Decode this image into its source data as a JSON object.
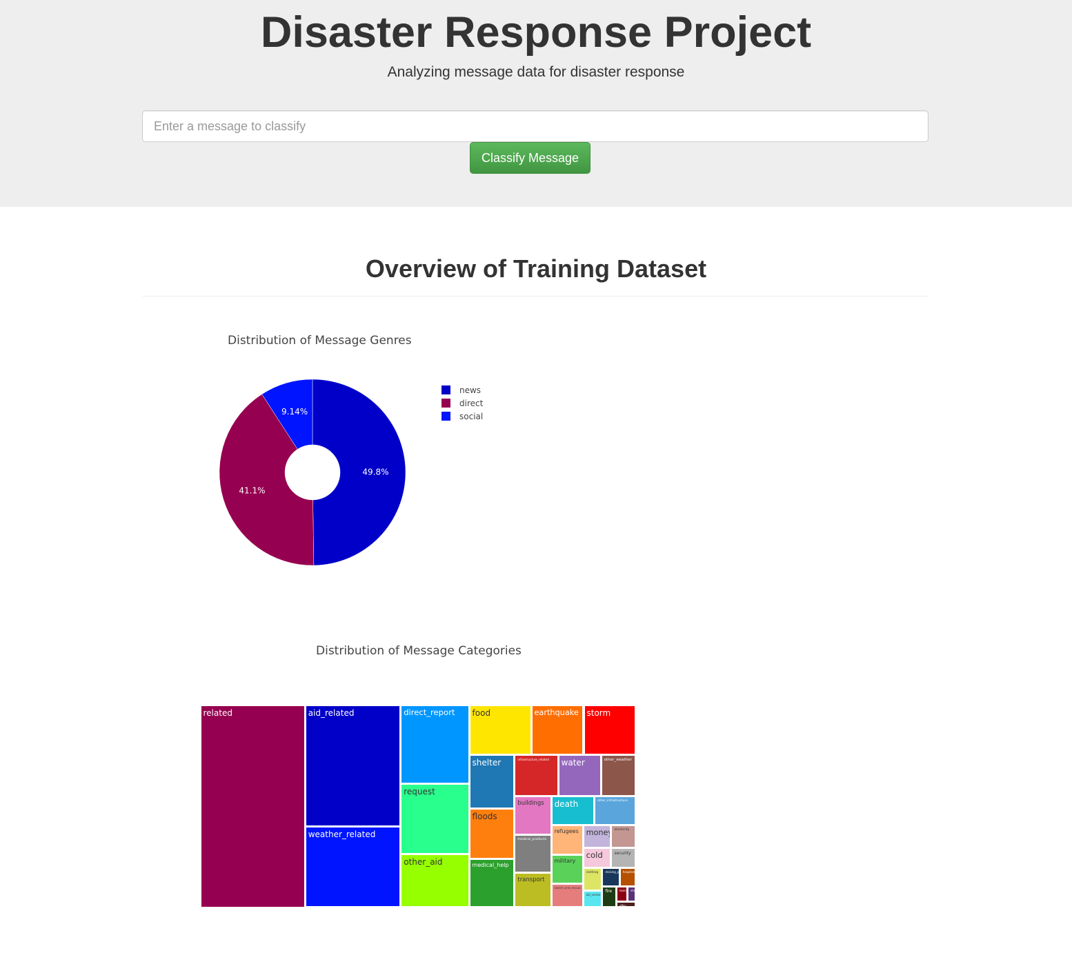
{
  "header": {
    "title": "Disaster Response Project",
    "subtitle": "Analyzing message data for disaster response",
    "input_placeholder": "Enter a message to classify",
    "button_label": "Classify Message"
  },
  "section": {
    "title": "Overview of Training Dataset"
  },
  "colors": {
    "jumbotron_bg": "#eeeeee",
    "button": "#5cb85c"
  },
  "chart_data": [
    {
      "type": "pie",
      "hole": true,
      "title": "Distribution of Message Genres",
      "labels": [
        "news",
        "direct",
        "social"
      ],
      "values": [
        49.8,
        41.1,
        9.14
      ],
      "text": [
        "49.8%",
        "41.1%",
        "9.14%"
      ],
      "colors": [
        "#0000c8",
        "#960050",
        "#0014ff"
      ],
      "legend": "right"
    },
    {
      "type": "treemap",
      "title": "Distribution of Message Categories",
      "categories": [
        "related",
        "aid_related",
        "weather_related",
        "direct_report",
        "request",
        "other_aid",
        "food",
        "earthquake",
        "storm",
        "shelter",
        "infrastructure_related",
        "water",
        "other_weather",
        "floods",
        "buildings",
        "death",
        "other_infrastructure",
        "medical_products",
        "refugees",
        "money",
        "electricity",
        "medical_help",
        "military",
        "cold",
        "security",
        "transport",
        "search_and_rescue",
        "clothing",
        "missing_people",
        "hospitals",
        "aid_centers",
        "fire",
        "tools",
        "shops",
        "offer"
      ],
      "values": [
        20000,
        10900,
        7300,
        5100,
        4500,
        3450,
        2900,
        2450,
        2450,
        2300,
        1700,
        1670,
        1370,
        2150,
        1330,
        1190,
        1150,
        1310,
        870,
        600,
        530,
        2080,
        860,
        530,
        470,
        1200,
        720,
        400,
        300,
        280,
        310,
        280,
        160,
        120,
        110
      ],
      "tile_colors": [
        "#960050",
        "#0000c8",
        "#0014ff",
        "#0096ff",
        "#28ff8c",
        "#96ff00",
        "#ffe600",
        "#ff6e00",
        "#ff0000",
        "#1f77b4",
        "#d62728",
        "#9467bd",
        "#8c564b",
        "#ff7f0e",
        "#e377c2",
        "#17becf",
        "#5aa5dc",
        "#7f7f7f",
        "#ffb478",
        "#c3b4dc",
        "#c39691",
        "#2ca02c",
        "#5ad25a",
        "#f5c8dc",
        "#b4b4b4",
        "#bcbd22",
        "#e67d7d",
        "#dce664",
        "#19375a",
        "#b45000",
        "#5ae6f0",
        "#1e3c14",
        "#8c0014",
        "#5a3278",
        "#4b1e1e"
      ]
    }
  ]
}
